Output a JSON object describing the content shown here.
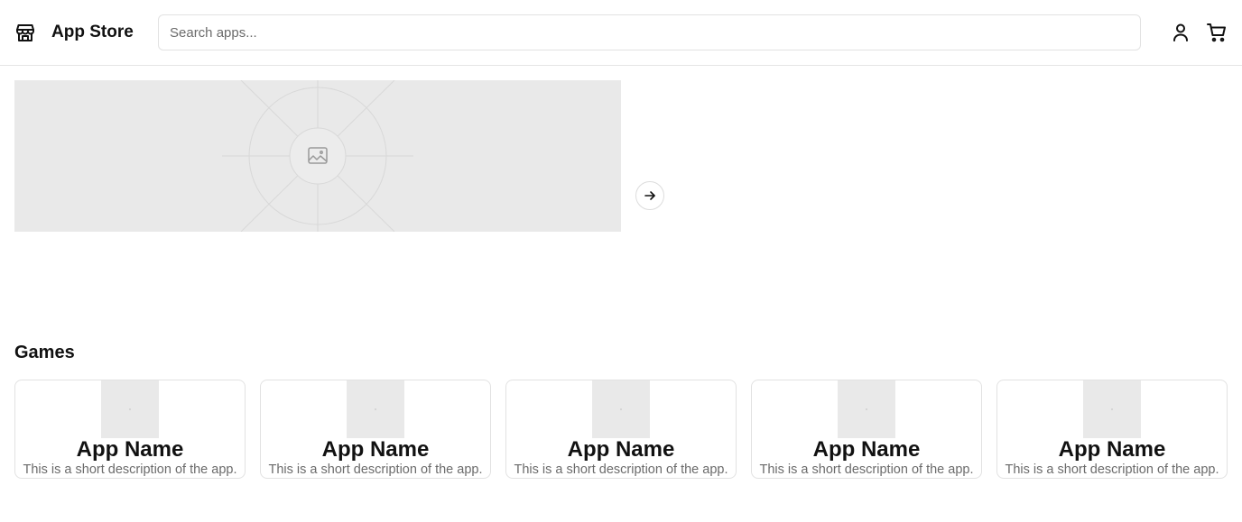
{
  "header": {
    "logo_icon": "store-icon",
    "title": "App Store",
    "search_placeholder": "Search apps...",
    "search_value": "",
    "user_icon": "user-icon",
    "cart_icon": "cart-icon"
  },
  "banner": {
    "image_icon": "image-placeholder-icon",
    "next_icon": "arrow-right-icon"
  },
  "sections": [
    {
      "title": "Games",
      "apps": [
        {
          "name": "App Name",
          "description": "This is a short description of the app."
        },
        {
          "name": "App Name",
          "description": "This is a short description of the app."
        },
        {
          "name": "App Name",
          "description": "This is a short description of the app."
        },
        {
          "name": "App Name",
          "description": "This is a short description of the app."
        },
        {
          "name": "App Name",
          "description": "This is a short description of the app."
        }
      ]
    }
  ],
  "colors": {
    "border": "#e2e2e2",
    "placeholder_bg": "#e9e9e9",
    "muted_text": "#6b6b6b",
    "text": "#111111"
  }
}
